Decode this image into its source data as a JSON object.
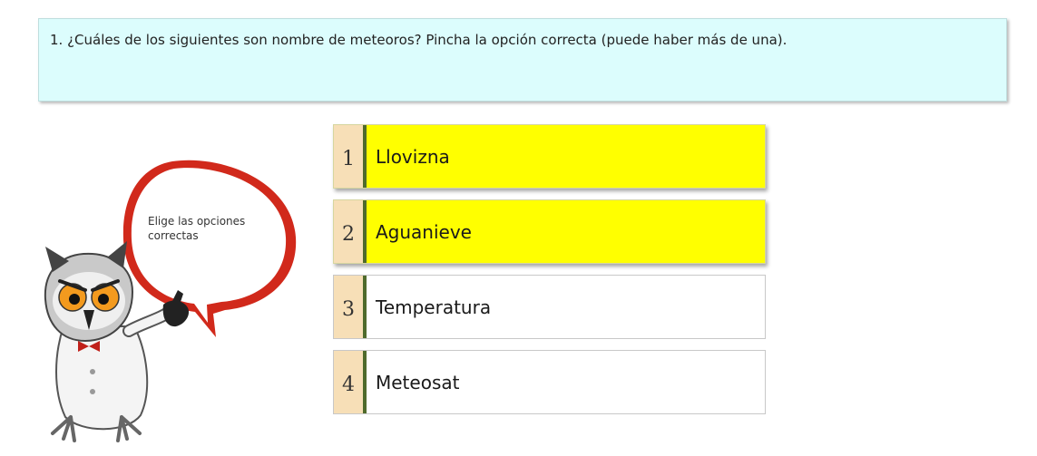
{
  "question": {
    "text": "1. ¿Cuáles de los siguientes son nombre de meteoros? Pincha la opción correcta (puede haber más de una)."
  },
  "mascot": {
    "bubble_line1": "Elige las opciones",
    "bubble_line2": "correctas"
  },
  "options": [
    {
      "number": "1",
      "label": "Llovizna",
      "selected": true
    },
    {
      "number": "2",
      "label": "Aguanieve",
      "selected": true
    },
    {
      "number": "3",
      "label": "Temperatura",
      "selected": false
    },
    {
      "number": "4",
      "label": "Meteosat",
      "selected": false
    }
  ],
  "colors": {
    "question_bg": "#dcfdfd",
    "selected_bg": "#ffff00",
    "number_bg": "#f7dfb7",
    "number_border": "#4f6b2c",
    "bubble_red": "#d1291b"
  }
}
